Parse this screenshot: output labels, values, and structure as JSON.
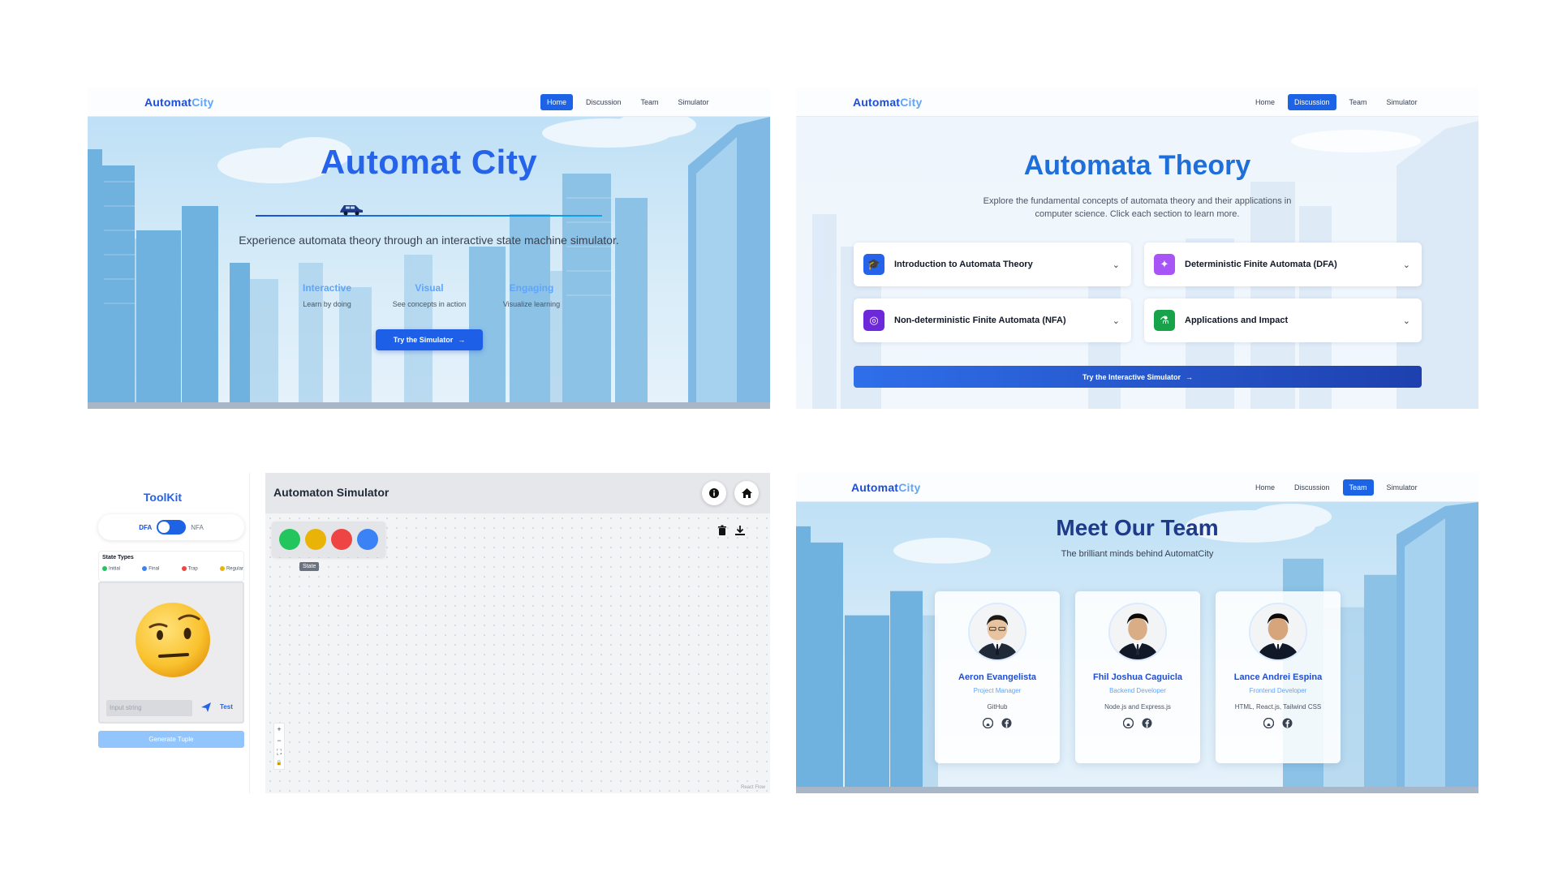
{
  "brand": {
    "part1": "Automat",
    "part2": "City"
  },
  "nav": {
    "home": "Home",
    "discussion": "Discussion",
    "team": "Team",
    "simulator": "Simulator"
  },
  "home": {
    "title": "Automat City",
    "subtitle": "Experience automata theory through an interactive state machine simulator.",
    "features": [
      {
        "title": "Interactive",
        "desc": "Learn by doing"
      },
      {
        "title": "Visual",
        "desc": "See concepts in action"
      },
      {
        "title": "Engaging",
        "desc": "Visualize learning"
      }
    ],
    "cta": "Try the Simulator",
    "active_nav": "Home"
  },
  "discussion": {
    "title": "Automata Theory",
    "subtitle": "Explore the fundamental concepts of automata theory and their applications in computer science. Click each section to learn more.",
    "sections": [
      {
        "label": "Introduction to Automata Theory",
        "icon": "graduation-cap-icon",
        "color": "#2563eb"
      },
      {
        "label": "Deterministic Finite Automata (DFA)",
        "icon": "puzzle-icon",
        "color": "#a855f7"
      },
      {
        "label": "Non-deterministic Finite Automata (NFA)",
        "icon": "lightbulb-icon",
        "color": "#6d28d9"
      },
      {
        "label": "Applications and Impact",
        "icon": "flask-icon",
        "color": "#16a34a"
      }
    ],
    "cta": "Try the Interactive Simulator",
    "active_nav": "Discussion"
  },
  "simulator": {
    "toolkit_title": "ToolKit",
    "mode_left": "DFA",
    "mode_right": "NFA",
    "state_types_title": "State Types",
    "state_types": [
      {
        "label": "Initial",
        "color": "#22c55e"
      },
      {
        "label": "Final",
        "color": "#3b82f6"
      },
      {
        "label": "Trap",
        "color": "#ef4444"
      },
      {
        "label": "Regular",
        "color": "#eab308"
      }
    ],
    "input_placeholder": "Input string",
    "test_label": "Test",
    "generate_label": "Generate Tuple",
    "canvas_title": "Automaton Simulator",
    "palette_colors": [
      "#22c55e",
      "#eab308",
      "#ef4444",
      "#3b82f6"
    ],
    "palette_tooltip": "State",
    "zoom_controls": [
      "+",
      "−",
      "⛶",
      "🔒"
    ],
    "attribution": "React Flow"
  },
  "team": {
    "title": "Meet Our Team",
    "subtitle": "The brilliant minds behind AutomatCity",
    "members": [
      {
        "name": "Aeron Evangelista",
        "role": "Project Manager",
        "skills": "GitHub"
      },
      {
        "name": "Fhil Joshua Caguicla",
        "role": "Backend Developer",
        "skills": "Node.js and Express.js"
      },
      {
        "name": "Lance Andrei Espina",
        "role": "Frontend Developer",
        "skills": "HTML, React.js, Tailwind CSS"
      }
    ],
    "active_nav": "Team"
  },
  "colors": {
    "primary": "#1d63e6",
    "accent": "#60a5fa",
    "heading_dark": "#1e3a8a"
  }
}
